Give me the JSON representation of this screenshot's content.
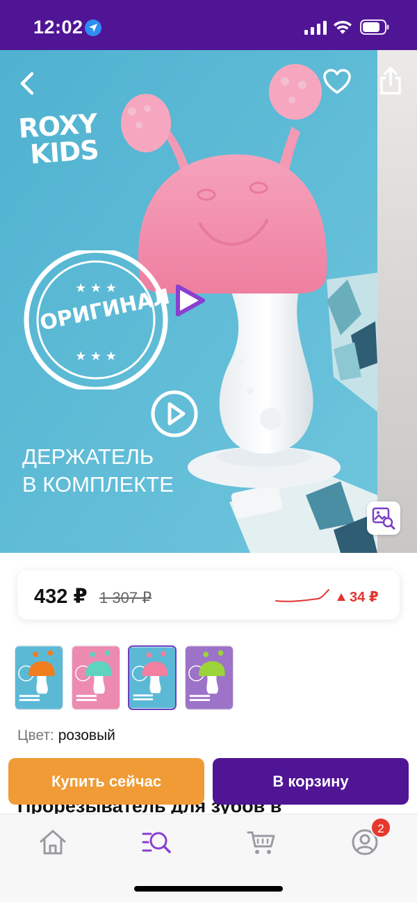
{
  "status_bar": {
    "time": "12:02"
  },
  "hero": {
    "brand_line1": "ROXY",
    "brand_line2": "KIDS",
    "stamp_text": "ОРИГИНАЛ",
    "caption_line1": "ДЕРЖАТЕЛЬ",
    "caption_line2": "В КОМПЛЕКТЕ"
  },
  "price": {
    "current": "432 ₽",
    "old": "1 307 ₽",
    "change": "34 ₽"
  },
  "variants": [
    {
      "color": "оранжевый",
      "cap_color": "#f07e1f",
      "bg": "#5cb9d6"
    },
    {
      "color": "мятный",
      "cap_color": "#5fd3c0",
      "bg": "#ec8ab0"
    },
    {
      "color": "розовый",
      "cap_color": "#f27fa0",
      "bg": "#5cb9d6",
      "selected": true
    },
    {
      "color": "салатовый",
      "cap_color": "#9bd33a",
      "bg": "#9d72c9"
    }
  ],
  "color_selector": {
    "label": "Цвет:",
    "value": "розовый"
  },
  "product_title_peek": "Прорезыватель для зубов в",
  "actions": {
    "buy_now": "Купить сейчас",
    "add_to_cart": "В корзину"
  },
  "tab_bar": {
    "items": [
      "home-icon",
      "catalog-search-icon",
      "cart-icon",
      "profile-icon"
    ],
    "profile_badge": "2"
  },
  "colors": {
    "brand_purple": "#4f1595",
    "buy_orange": "#f09b35",
    "price_up_red": "#e3342f"
  }
}
